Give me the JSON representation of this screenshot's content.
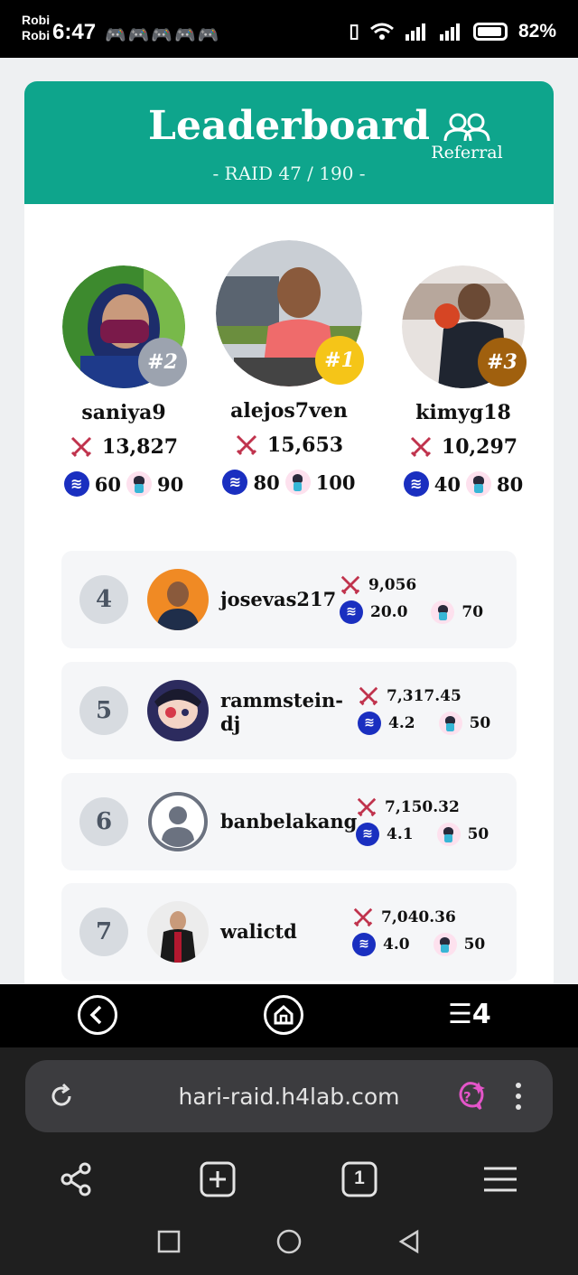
{
  "status_bar": {
    "carrier_line1": "Robi",
    "carrier_line2": "Robi",
    "time": "6:47",
    "battery": "82%"
  },
  "header": {
    "title": "Leaderboard",
    "subtitle": "- RAID 47 / 190 -",
    "referral_label": "Referral"
  },
  "podium": [
    {
      "rank": "#2",
      "name": "saniya9",
      "score": "13,827",
      "steem": "60",
      "hero": "90",
      "badge_color": "#9ca3af"
    },
    {
      "rank": "#1",
      "name": "alejos7ven",
      "score": "15,653",
      "steem": "80",
      "hero": "100",
      "badge_color": "#f5c518"
    },
    {
      "rank": "#3",
      "name": "kimyg18",
      "score": "10,297",
      "steem": "40",
      "hero": "80",
      "badge_color": "#a0600e"
    }
  ],
  "leaderboard": [
    {
      "rank": "4",
      "name": "josevas217",
      "score": "9,056",
      "steem": "20.0",
      "hero": "70"
    },
    {
      "rank": "5",
      "name_line1": "rammstein-",
      "name_line2": "dj",
      "score": "7,317.45",
      "steem": "4.2",
      "hero": "50"
    },
    {
      "rank": "6",
      "name": "banbelakang",
      "score": "7,150.32",
      "steem": "4.1",
      "hero": "50"
    },
    {
      "rank": "7",
      "name": "walictd",
      "score": "7,040.36",
      "steem": "4.0",
      "hero": "50"
    }
  ],
  "nav_bar": {
    "app_label": "H4"
  },
  "browser": {
    "url": "hari-raid.h4lab.com",
    "tab_count": "1"
  },
  "colors": {
    "header_green": "#0ea58c",
    "steem_blue": "#1a2fc0",
    "sword_red": "#c0334d"
  }
}
